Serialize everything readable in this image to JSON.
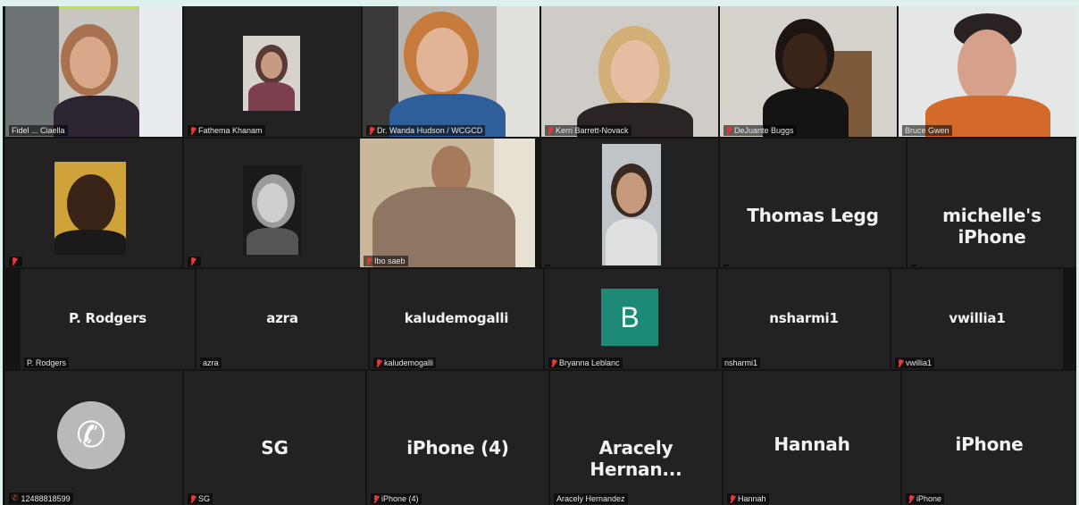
{
  "app": {
    "accent": "#1c8a77",
    "active_speaker_color": "#b7e24a",
    "muted_color": "#e03a3a"
  },
  "row1": [
    {
      "label": "Fidel ... Ciaella"
    },
    {
      "label": "Fathema Khanam"
    },
    {
      "label": "Dr. Wanda Hudson / WCGCD"
    },
    {
      "label": "Kerri Barrett-Novack"
    },
    {
      "label": "DeJuante Buggs"
    },
    {
      "label": "Bruce Gwen"
    }
  ],
  "row2": [
    {
      "label": ""
    },
    {
      "label": ""
    },
    {
      "label": "Ibo saeb"
    },
    {
      "label": ""
    },
    {
      "name": "Thomas Legg",
      "label": ""
    },
    {
      "name": "michelle's iPhone",
      "label": ""
    }
  ],
  "row3": [
    {
      "name": "P. Rodgers",
      "label": "P. Rodgers"
    },
    {
      "name": "azra",
      "label": "azra"
    },
    {
      "name": "kaludemogalli",
      "label": "kaludemogalli"
    },
    {
      "avatar_letter": "B",
      "label": "Bryanna Leblanc"
    },
    {
      "name": "nsharmi1",
      "label": "nsharmi1"
    },
    {
      "name": "vwillia1",
      "label": "vwillia1"
    }
  ],
  "row4": [
    {
      "label": "12488818599"
    },
    {
      "name": "SG",
      "label": "SG"
    },
    {
      "name": "iPhone (4)",
      "label": "iPhone (4)"
    },
    {
      "name": "Aracely  Hernan...",
      "label": "Aracely Hernandez"
    },
    {
      "name": "Hannah",
      "label": "Hannah"
    },
    {
      "name": "iPhone",
      "label": "iPhone"
    }
  ]
}
